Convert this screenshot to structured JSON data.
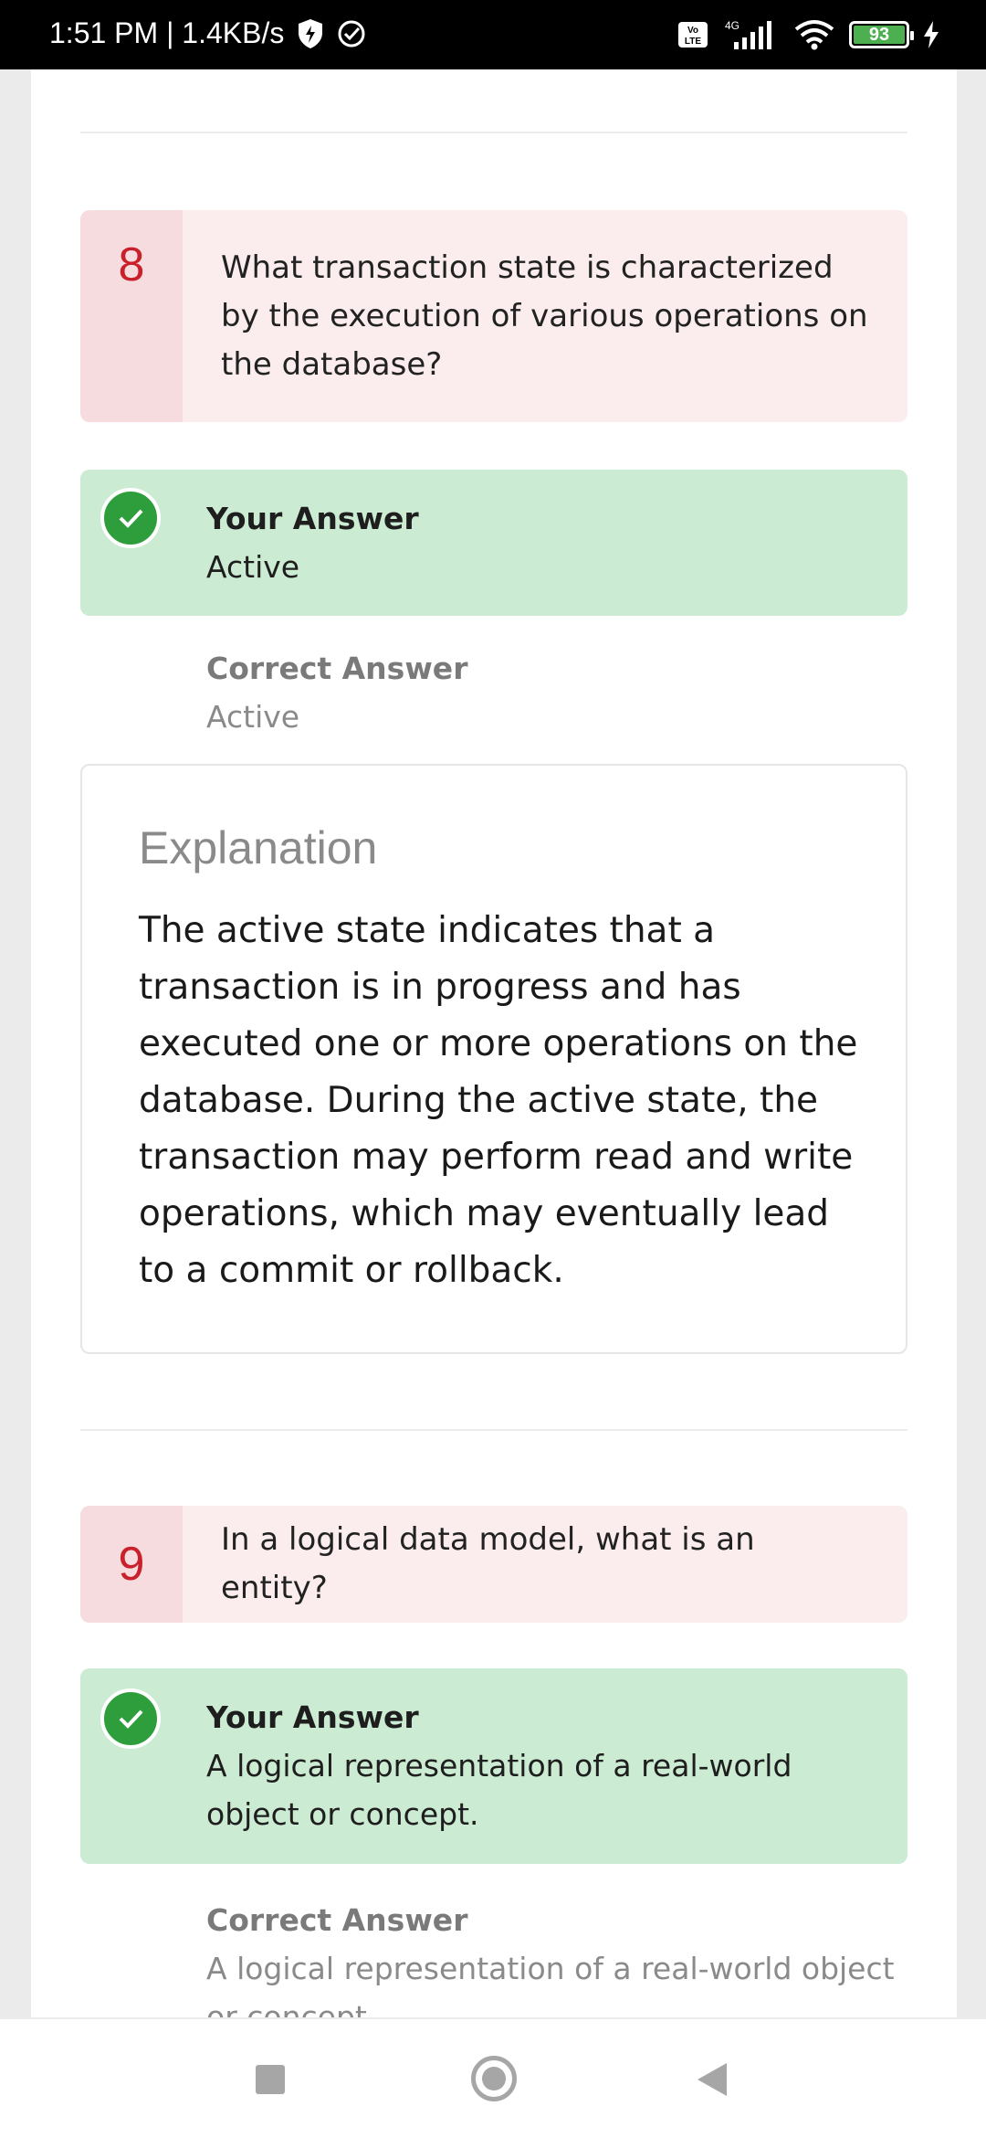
{
  "status_bar": {
    "time_speed": "1:51 PM | 1.4KB/s",
    "network": "4G",
    "volte": "Vo LTE",
    "battery_level": "93"
  },
  "questions": [
    {
      "number": "8",
      "text": "What transaction state is characterized by the execution of various operations on the database?",
      "your_answer_label": "Your Answer",
      "your_answer": "Active",
      "correct_answer_label": "Correct Answer",
      "correct_answer": "Active",
      "explanation_title": "Explanation",
      "explanation": "The active state indicates that a transaction is in progress and has executed one or more operations on the database. During the active state, the transaction may perform read and write operations, which may eventually lead to a commit or rollback."
    },
    {
      "number": "9",
      "text": "In a logical data model, what is an entity?",
      "your_answer_label": "Your Answer",
      "your_answer": "A logical representation of a real-world object or concept.",
      "correct_answer_label": "Correct Answer",
      "correct_answer": "A logical representation of a real-world object or concept."
    }
  ],
  "colors": {
    "question_bg": "#fbeded",
    "number_bg": "#f7dcdf",
    "number_text": "#c9202b",
    "answer_bg": "#ccebd3",
    "check_green": "#2e9e3c"
  }
}
